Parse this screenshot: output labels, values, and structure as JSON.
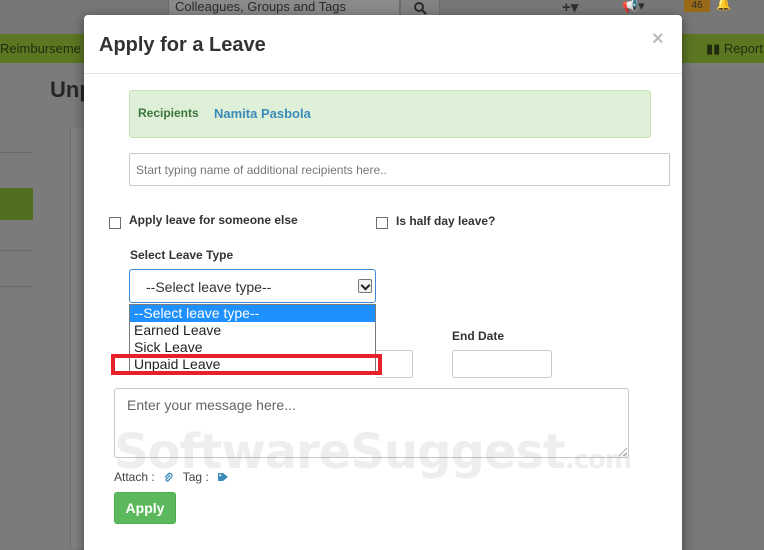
{
  "background": {
    "search_placeholder": "Colleagues, Groups and Tags",
    "notification_count": "46",
    "nav_left": "Reimburseme",
    "nav_right": "Report",
    "page_title": "Unp"
  },
  "modal": {
    "title": "Apply for a Leave",
    "close": "×",
    "recipients_label": "Recipients",
    "recipients_name": "Namita Pasbola",
    "recipients_placeholder": "Start typing name of additional recipients here..",
    "apply_for_else_label": "Apply leave for someone else",
    "half_day_label": "Is half day leave?",
    "leave_type_label": "Select Leave Type",
    "leave_type_selected": "--Select leave type--",
    "leave_type_options": [
      "--Select leave type--",
      "Earned Leave",
      "Sick Leave",
      "Unpaid Leave"
    ],
    "end_date_label": "End Date",
    "message_placeholder": "Enter your message here...",
    "attach_label": "Attach :",
    "tag_label": "Tag :",
    "apply_button": "Apply"
  },
  "watermark": {
    "main": "SoftwareSuggest",
    "suffix": ".com"
  },
  "colors": {
    "nav_green": "#5c7722",
    "recipients_bg": "#dff0d8",
    "apply_green": "#5cb85c",
    "highlight_red": "#e8202a",
    "selected_option_blue": "#1e90ff"
  }
}
